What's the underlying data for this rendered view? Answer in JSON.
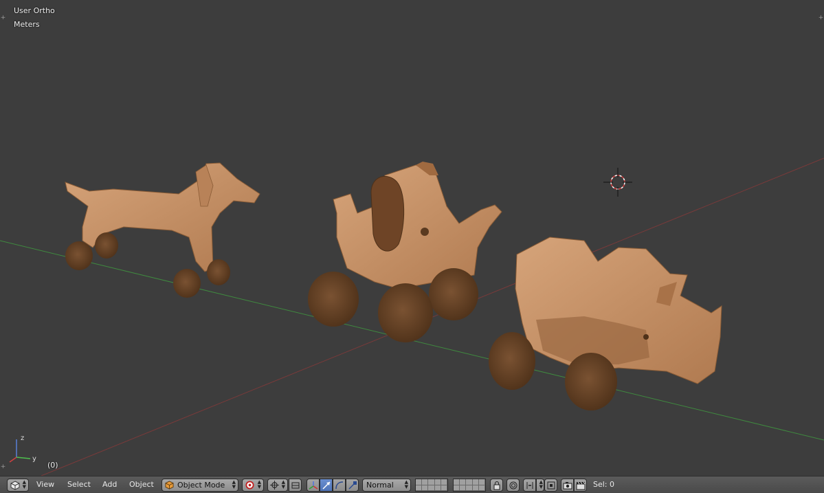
{
  "viewport": {
    "view_name": "User Ortho",
    "units": "Meters",
    "frame": "(0)",
    "axis_labels": {
      "z": "z",
      "y": "y"
    }
  },
  "header": {
    "menus": {
      "view": "View",
      "select": "Select",
      "add": "Add",
      "object": "Object"
    },
    "mode": "Object Mode",
    "orientation": "Normal",
    "selection_count": "Sel: 0"
  },
  "colors": {
    "viewport_bg": "#3d3d3d",
    "grid_x_axis": "#8a3a3a",
    "grid_y_axis": "#3f8a3f",
    "wood_light": "#c8946a",
    "wood_dark": "#6a4528",
    "header_bg": "#4d4d4d",
    "active_blue": "#5680c2"
  },
  "icons": {
    "editor_type": "cube-editor-icon",
    "mode": "object-mode-cube-icon",
    "shading": "solid-shading-icon",
    "pivot": "pivot-point-icon",
    "manipulator": "manipulator-icon",
    "translate": "translate-arrow-icon",
    "rotate": "rotate-arc-icon",
    "scale": "scale-icon",
    "lock": "layer-lock-icon",
    "proportional": "proportional-edit-icon",
    "snap": "snap-magnet-icon",
    "render": "render-camera-icon",
    "clapper": "render-animation-icon"
  }
}
